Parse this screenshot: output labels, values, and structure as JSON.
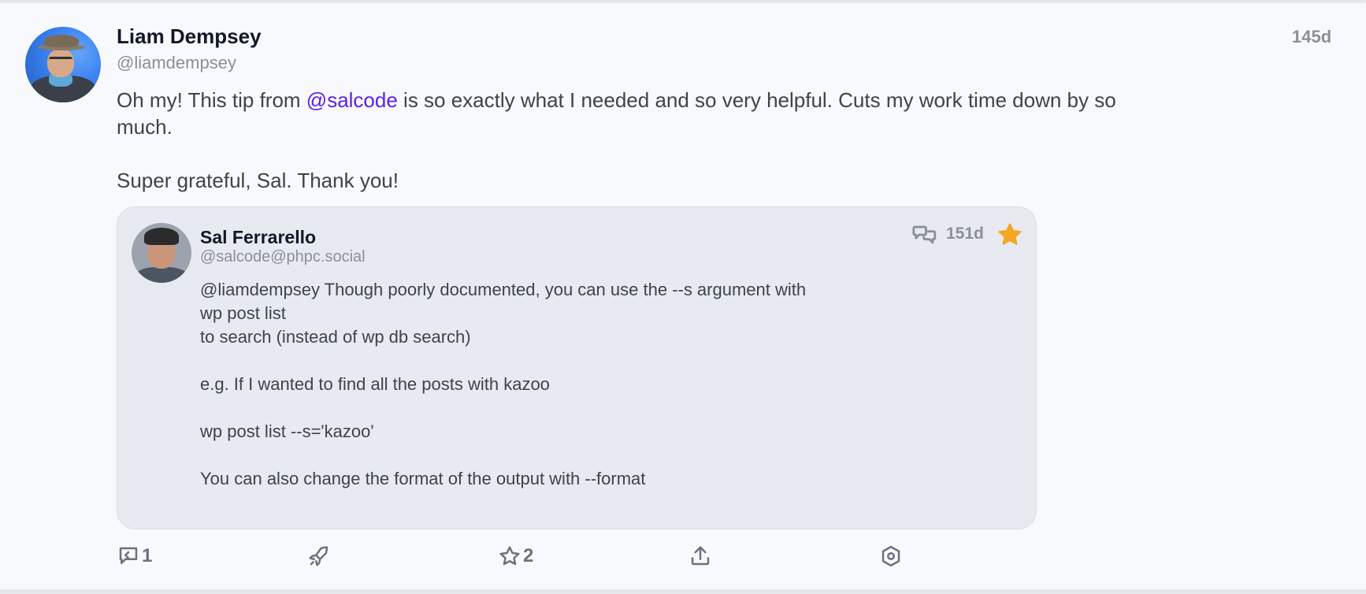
{
  "post": {
    "author": {
      "name": "Liam Dempsey",
      "handle": "@liamdempsey"
    },
    "time": "145d",
    "content": {
      "line1_before": "Oh my! This tip from ",
      "mention": "@salcode",
      "line1_after": " is so exactly what I needed and so very helpful. Cuts my work time down by so much.",
      "line2": "Super grateful, Sal. Thank you!"
    },
    "quote": {
      "author": {
        "name": "Sal Ferrarello",
        "handle": "@salcode@phpc.social"
      },
      "time": "151d",
      "lines": [
        "@liamdempsey Though poorly documented, you can use the --s argument with",
        "wp post list",
        "to search (instead of wp db search)",
        "",
        "e.g. If I wanted to find all the posts with kazoo",
        "",
        "wp post list --s='kazoo'",
        "",
        "You can also change the format of the output with --format"
      ]
    },
    "actions": {
      "reply_count": "1",
      "favourite_count": "2"
    }
  },
  "icons": {
    "reply": "reply-icon",
    "boost": "boost-rocket-icon",
    "favourite": "star-icon",
    "share": "share-icon",
    "more": "settings-icon",
    "quote_reply": "conversation-icon",
    "quote_star": "star-filled-icon"
  },
  "colors": {
    "accent": "#5b21e6",
    "star": "#f5a623",
    "muted": "#8a8f99"
  }
}
